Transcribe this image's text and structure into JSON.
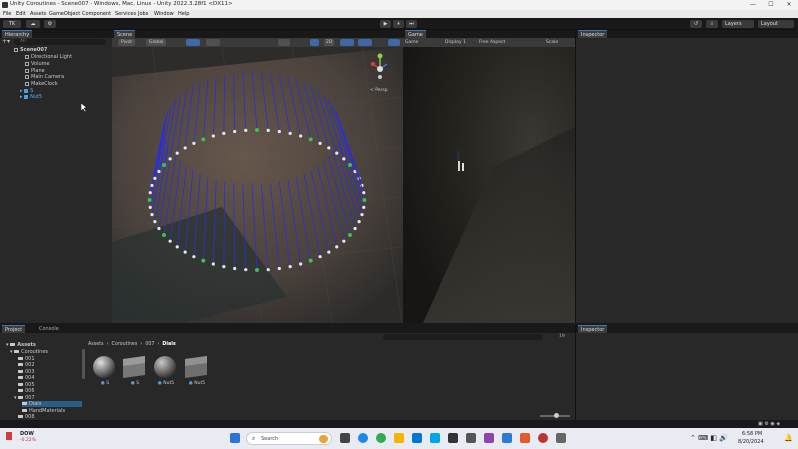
{
  "window": {
    "title": "Unity Coroutines - Scene007 - Windows, Mac, Linux - Unity 2022.3.28f1 <DX11>",
    "controls": [
      "—",
      "☐",
      "✕"
    ]
  },
  "menu": [
    "File",
    "Edit",
    "Assets",
    "GameObject",
    "Component",
    "Services",
    "Jobs",
    "Window",
    "Help"
  ],
  "toolbar": {
    "account": "TK",
    "play_icon": "▶",
    "pause_icon": "⏸",
    "step_icon": "⏭",
    "layers": "Layers",
    "layout": "Layout"
  },
  "hierarchy": {
    "tab": "Hierarchy",
    "search_placeholder": "All",
    "scene": "Scene007",
    "items": [
      "Directional Light",
      "Volume",
      "Plane",
      "Main Camera",
      "MakeClock",
      "S",
      "Nut5"
    ]
  },
  "scene_view": {
    "tab": "Scene",
    "pivot": "Pivot",
    "global": "Global",
    "persp": "< Persp",
    "mode_2d": "2D"
  },
  "game_view": {
    "tab": "Game",
    "display_mode": "Game",
    "display": "Display 1",
    "aspect": "Free Aspect",
    "scale": "Scale"
  },
  "inspector": {
    "tab": "Inspector",
    "tab2": "Inspector"
  },
  "project": {
    "tab": "Project",
    "console_tab": "Console",
    "breadcrumb": [
      "Assets",
      "Coroutines",
      "007",
      "Dials"
    ],
    "tree": {
      "assets": "Assets",
      "coroutines": "Coroutines",
      "folders": [
        "001",
        "002",
        "003",
        "004",
        "005",
        "006",
        "007"
      ],
      "dials": "Dials",
      "hand_materials": "HandMaterials",
      "f008": "008"
    },
    "assets_grid": [
      {
        "label": "S",
        "kind": "sphere"
      },
      {
        "label": "S",
        "kind": "cube"
      },
      {
        "label": "Nut5",
        "kind": "sphere"
      },
      {
        "label": "Nut5",
        "kind": "cube"
      }
    ],
    "count": "19"
  },
  "taskbar": {
    "stock_name": "DOW",
    "stock_change": "-0.22%",
    "search": "Search",
    "time": "6:58 PM",
    "date": "8/20/2024"
  }
}
